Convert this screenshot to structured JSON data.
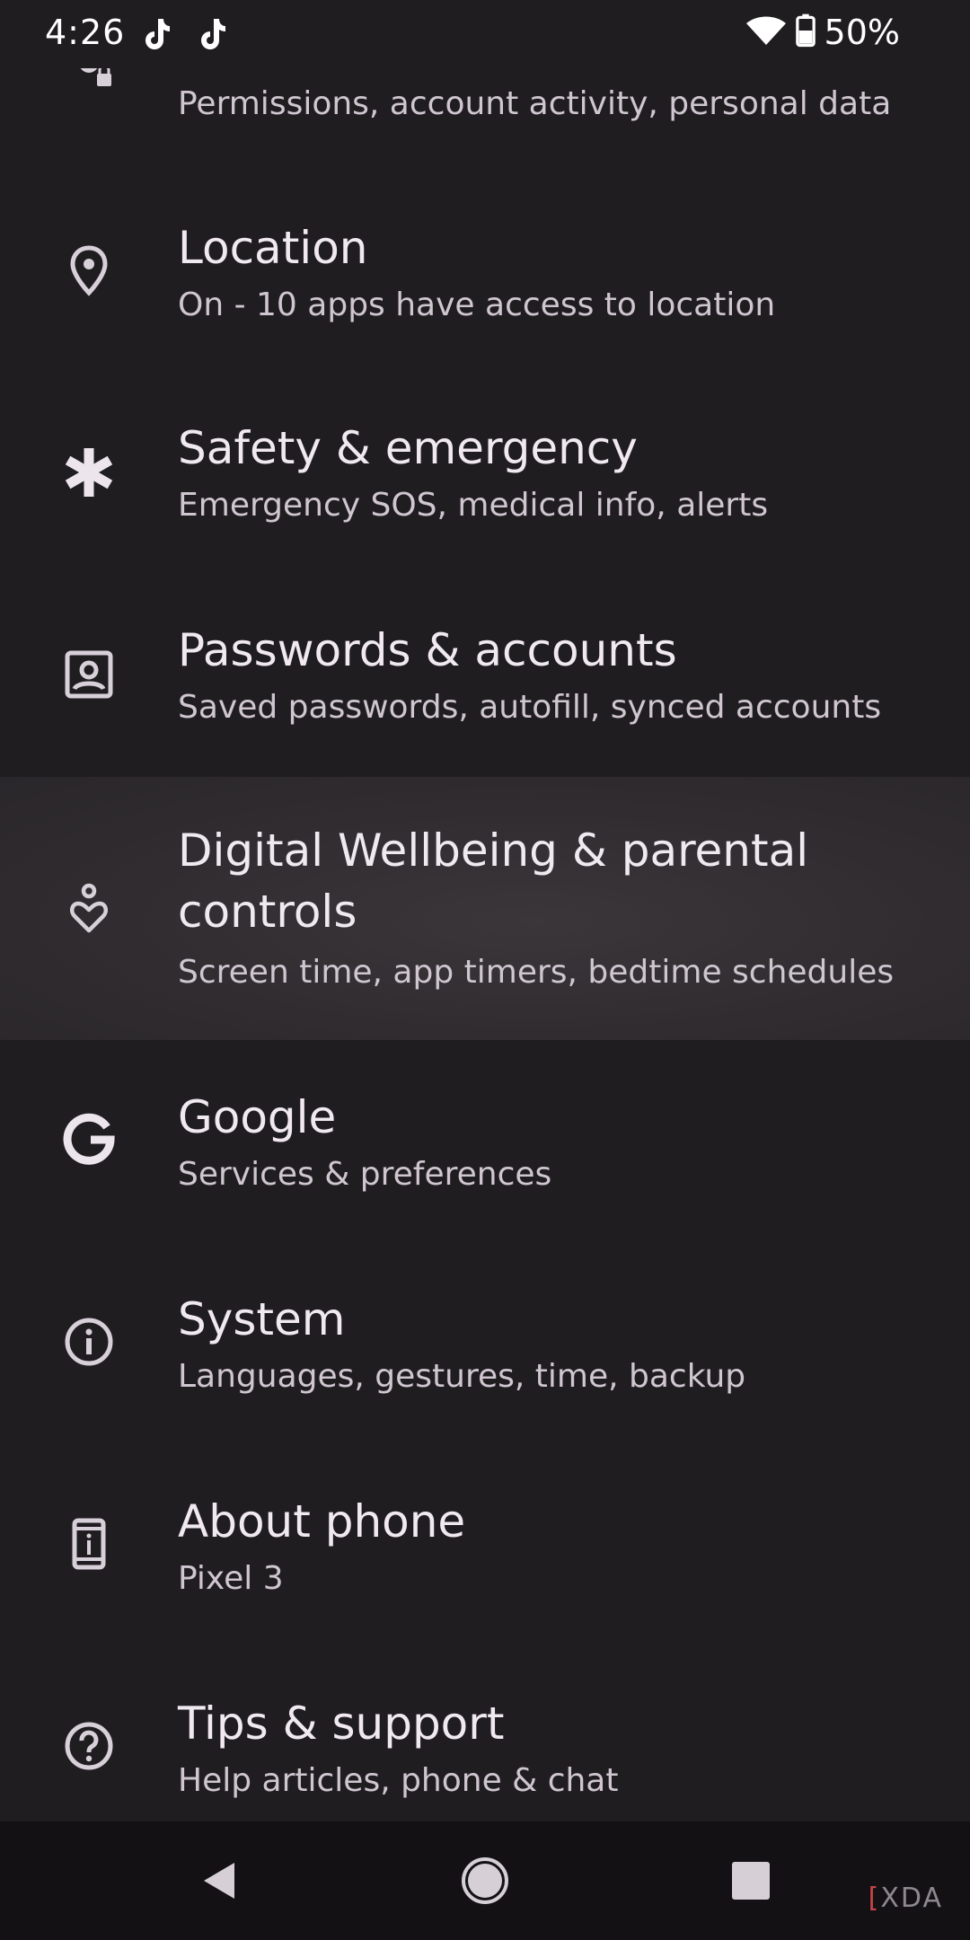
{
  "status_bar": {
    "time": "4:26",
    "battery_percent": "50%",
    "notification_icons": [
      "tiktok-icon",
      "tiktok-icon"
    ],
    "system_icons": [
      "wifi-icon",
      "battery-icon"
    ]
  },
  "settings": {
    "items": [
      {
        "id": "privacy",
        "title": "",
        "subtitle": "Permissions, account activity, personal data",
        "icon": "privacy-icon"
      },
      {
        "id": "location",
        "title": "Location",
        "subtitle": "On - 10 apps have access to location",
        "icon": "location-pin-icon"
      },
      {
        "id": "safety",
        "title": "Safety & emergency",
        "subtitle": "Emergency SOS, medical info, alerts",
        "icon": "asterisk-icon"
      },
      {
        "id": "passwords",
        "title": "Passwords & accounts",
        "subtitle": "Saved passwords, autofill, synced accounts",
        "icon": "account-box-icon"
      },
      {
        "id": "wellbeing",
        "title": "Digital Wellbeing & parental controls",
        "subtitle": "Screen time, app timers, bedtime schedules",
        "icon": "wellbeing-heart-icon",
        "highlighted": true
      },
      {
        "id": "google",
        "title": "Google",
        "subtitle": "Services & preferences",
        "icon": "google-g-icon"
      },
      {
        "id": "system",
        "title": "System",
        "subtitle": "Languages, gestures, time, backup",
        "icon": "info-circle-icon"
      },
      {
        "id": "about",
        "title": "About phone",
        "subtitle": "Pixel 3",
        "icon": "phone-info-icon"
      },
      {
        "id": "tips",
        "title": "Tips & support",
        "subtitle": "Help articles, phone & chat",
        "icon": "help-circle-icon"
      }
    ]
  },
  "nav_bar": {
    "buttons": [
      "back-icon",
      "home-icon",
      "recents-icon"
    ]
  },
  "watermark": {
    "text": "XDA"
  },
  "colors": {
    "background": "#201d21",
    "highlight": "#302c30",
    "title_text": "#f0eaf0",
    "subtitle_text": "#cfc6cf",
    "nav_background": "#131113"
  }
}
